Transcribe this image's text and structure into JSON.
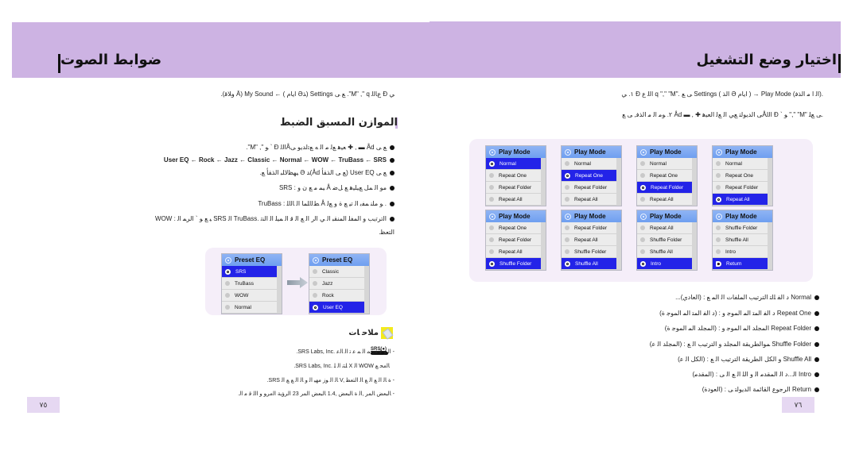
{
  "left_page": {
    "title": "ضوابط الصوت",
    "intro_line": ".(ﻭﻼﻗ Ā) My Sound ← ( ﺍﻳﺎﻡ Əﺬ) Settings ﻊ ﻰ .\"M\" ,\" q ﻉﺎﻟﻟ Ð ﻲ",
    "subheading": "الموازن المسبق الضبط",
    "bullets": [
      ".\"M\" ,\" ﻮ ` Ð ﺍﻟﻟÅﻌﻴﻫ ﻊﻟ ﻣ ﺍﻟ ﻪ ﻊﺗﻟﺪﻳﻮ ﻰ ✚ , ▬ Åd ﻊ ﻰ",
      "User EQ ← Rock ← Jazz ← Classic ← Normal ← WOW ← TruBass ← SRS",
      ".ﻴﻬﻈﻟﺎﻠﺒ ﺍﻟﺬﻘﺄ ﻊ Ə ﺪ(Åd ﻊ ﻰ ﺍﻟﺬﻘﺄ) User EQ ﻊ ﻰ",
      "SRS : ﻴﻤ ﻣ ﻊ ﻥ ﻭ Å ﻣﻮ ﺍﻟ ﻤﻞ ﻊﻴﻠﻴﻫ ﻊ ﻞﺿ",
      "TruBass : ﻂﻟﺍﻠﻤﺎ ﺍﻟ ﺎﻟﺍﻠ Å ﻮ ﻣﻠﻨ ﻤﻔﺑ ﺍﻟ ﺗﻴ ﻊ ﺓ ﻭ ﻊﻟ .",
      "WOW : ﻴ ﻊ ﻮ ` ﺍﻟﺮﻤ ﺍﻟ SRS ﺍﻟ TruBass. ﺍﻟﺗﺮﺗﻳﺐ ﻭ ﺍﻟﻤﻔﻠ ﺍﻟﻤﻨﻘﺒ ﺍﻟ ﻲ ﺍﻟﺭ ﺍﻟ ﻊ ﺍﻟ ﻗ ﺍﻟ ﻤﻴﻠ ﺍﻟ ﺍﻟﻨﺗ",
      ".ﺍﻟﺘﻌﻈ"
    ],
    "bullet_keywords": [
      "",
      "",
      "",
      "SRS :",
      "TruBass :",
      "WOW :",
      ""
    ],
    "eq_screens": [
      {
        "header": "Preset EQ",
        "rows": [
          {
            "label": "SRS",
            "selected": true
          },
          {
            "label": "TruBass",
            "selected": false
          },
          {
            "label": "WOW",
            "selected": false
          },
          {
            "label": "Normal",
            "selected": false
          }
        ]
      },
      {
        "header": "Preset EQ",
        "rows": [
          {
            "label": "Classic",
            "selected": false
          },
          {
            "label": "Jazz",
            "selected": false
          },
          {
            "label": "Rock",
            "selected": false
          },
          {
            "label": "User EQ",
            "selected": true
          }
        ]
      }
    ],
    "tip": {
      "label": "ﻣﻼﺣ ﺎﺕ",
      "srs_logo_text": "SRS(●)",
      "notes": [
        ".SRS Labs, Inc. ﺍﻟ ﻮ ﻗ ﻔﺮ ﻤ ﺍﻟ ﻤ ﻋ ﺗ ﺍﻟ ﺎﻟﻋ",
        ".SRS Labs, Inc. ﻠﺘﻧ ﺍﻟ ﻠ X ﺍﻟ WOW ﺎﻟﻣﺤ ﻊ",
        ".SRS ﺎﻟ ﺍﻟ ﻮﺯ ﻣﻬﻴ ﺍﻟ ﻭ ﺎﻟ ﺍﻟ ﻊ ﻊ ﺍﻟ V, ﺓ ﺎﻟ ﺍﻟ ﻊ ﺍﻟ ﻊ ﺎﻟ ﺍﻟﺘﻌﻈ",
        ".ﺎﻟﺒﻌﺾ ﺎﻟﻤﺮ ,ﺍﻟ ﺓ ﺎﻟﺒﻌﺾ ,1.4 ﺎﻟﺒﻌﺾ ﺍﻟﻤﺮ 23 ﺍﻟﺮﺅﻳﺔ ﺍﻟﻣﺮﻮ ﻭ ﺍﻟﻟ ﻗ ﻣ ﺍﻟ"
      ]
    },
    "page_number": "٧٥"
  },
  "right_page": {
    "title": "اختيار وضع التشغيل",
    "steps": [
      "١. ﻲ Ð ﺍﻟﻟ ﻉ q \",\" \"M\". ﻰ ﻊ Settings ( ﺍﻟﺬ Ə ﺍﻳﺎﻡ ) → Play Mode (ﺍﻟ ﺍ ﻣ ﺍﻟﺬﻓ).",
      "٢. ﻮﻣ ﺍﻟ ﻣ ﺍﻟﺬﻓ, ﻰ ﻊ Åd ▬ , ✚ ﻰ ﺍﻟﺪﻳﻮﻟﺘ ﻊﻲ ﺍﻟ ﻊﻟ ﺍﻟﻌﻴﻫÅﺍﻟﻟ Ð ` ﻮ \",\" \"M\" ﻰ ﻊﻠ."
    ],
    "screens": [
      {
        "header": "Play Mode",
        "rows": [
          {
            "label": "Normal",
            "selected": true
          },
          {
            "label": "Repeat One",
            "selected": false
          },
          {
            "label": "Repeat Folder",
            "selected": false
          },
          {
            "label": "Repeat All",
            "selected": false
          }
        ]
      },
      {
        "header": "Play Mode",
        "rows": [
          {
            "label": "Normal",
            "selected": false
          },
          {
            "label": "Repeat One",
            "selected": true
          },
          {
            "label": "Repeat Folder",
            "selected": false
          },
          {
            "label": "Repeat All",
            "selected": false
          }
        ]
      },
      {
        "header": "Play Mode",
        "rows": [
          {
            "label": "Normal",
            "selected": false
          },
          {
            "label": "Repeat One",
            "selected": false
          },
          {
            "label": "Repeat Folder",
            "selected": true
          },
          {
            "label": "Repeat All",
            "selected": false
          }
        ]
      },
      {
        "header": "Play Mode",
        "rows": [
          {
            "label": "Normal",
            "selected": false
          },
          {
            "label": "Repeat One",
            "selected": false
          },
          {
            "label": "Repeat Folder",
            "selected": false
          },
          {
            "label": "Repeat All",
            "selected": true
          }
        ]
      },
      {
        "header": "Play Mode",
        "rows": [
          {
            "label": "Repeat One",
            "selected": false
          },
          {
            "label": "Repeat Folder",
            "selected": false
          },
          {
            "label": "Repeat All",
            "selected": false
          },
          {
            "label": "Shuffle Folder",
            "selected": true
          }
        ]
      },
      {
        "header": "Play Mode",
        "rows": [
          {
            "label": "Repeat Folder",
            "selected": false
          },
          {
            "label": "Repeat All",
            "selected": false
          },
          {
            "label": "Shuffle Folder",
            "selected": false
          },
          {
            "label": "Shuffle All",
            "selected": true
          }
        ]
      },
      {
        "header": "Play Mode",
        "rows": [
          {
            "label": "Repeat All",
            "selected": false
          },
          {
            "label": "Shuffle Folder",
            "selected": false
          },
          {
            "label": "Shuffle All",
            "selected": false
          },
          {
            "label": "Intro",
            "selected": true
          }
        ]
      },
      {
        "header": "Play Mode",
        "rows": [
          {
            "label": "Shuffle Folder",
            "selected": false
          },
          {
            "label": "Shuffle All",
            "selected": false
          },
          {
            "label": "Intro",
            "selected": false
          },
          {
            "label": "Return",
            "selected": true,
            "return_icon": true
          }
        ]
      }
    ],
    "descriptions": [
      {
        "keyword": "Normal",
        "text": "...ﺩ ﺍﻟﻔ ﻠﻟﺘ ﺍﻟﺘﺮﺗﻴﺐ ﺍﻟﻤﻠﻔﺎﺕ ﺍﻟ ﺍﻟﻤ ﻊ : (ﺍﻟﻌﺎﺩﻱ) Normal"
      },
      {
        "keyword": "Repeat One",
        "text": "ﺩ ﺍﻟﻔ ﺍﻟﻤﺘ ﺍﻟﻤ ﺍﻟﻤﻮﺟ ﻭ : (ﺩ ﺍﻟﻔ ﺍﻟﻤﺘ ﺍﻟﻤ ﺍﻟﻤﻮﺟ ﺓ) Repeat One"
      },
      {
        "keyword": "Repeat Folder",
        "text": "ﺍﻟﻤﺠﻠﺪ ﺍﻟﻤ ﺍﻟﻤﻮﺟ ﻭ : (ﺍﻟﻤﺠﻠﺪ ﺍﻟﻤ ﺍﻟﻤﻮﺟ ﺓ) Repeat Folder"
      },
      {
        "keyword": "Shuffle Folder",
        "text": "ﻤﻮﺍﻟﻄﺮﻳﻘﺔ ﺍﻟﻤﺠﻠﺪ ﻭ ﺍﻟﺘﺮﺗﻴﺐ ﺍﻟ ﻊ : (ﺍﻟﻤﺠﻠﺪ ﺍﻟ ﻋ) Shuffle Folder"
      },
      {
        "keyword": "Shuffle All",
        "text": "ﻭ ﺍﻟﻜﻞ ﺍﻟﻄﺮﻳﻘﺔ ﺍﻟﺘﺮﺗﻴﺐ ﺍﻟ ﻊ : (ﺍﻟﻜﻞ ﺍﻟ ﻋ) Shuffle All"
      },
      {
        "keyword": "Intro",
        "text": "ﺍﻟ...ﺩ ﺍﻟ ﺍﻟﻤﻘﺪﻣ ﺍﻟ ﻭ ﺍﻟﻠ ﺍﻟ ﻊ ﺍﻟ ﻰ : (ﺍﻟﻤﻘﺪﻣ) Intro"
      },
      {
        "keyword": "Return",
        "text": "ﺍﻟﺮﺟﻮﻉ ﺍﻟﻘﺎﺋﻤﺔ ﺍﻟﺪﻳﻮﻟﺘ ﻰ : (ﺍﻟﻌﻮﺩﺓ) Return"
      }
    ],
    "page_number": "٧٦"
  },
  "colors": {
    "header_band": "#cdb3e3",
    "page_number_bg": "#e6d8f2",
    "panel_bg": "#f5eef9",
    "selected_row": "#2323e8",
    "screen_header": "#7fa9f2",
    "tip_yellow": "#f3ea1b"
  }
}
